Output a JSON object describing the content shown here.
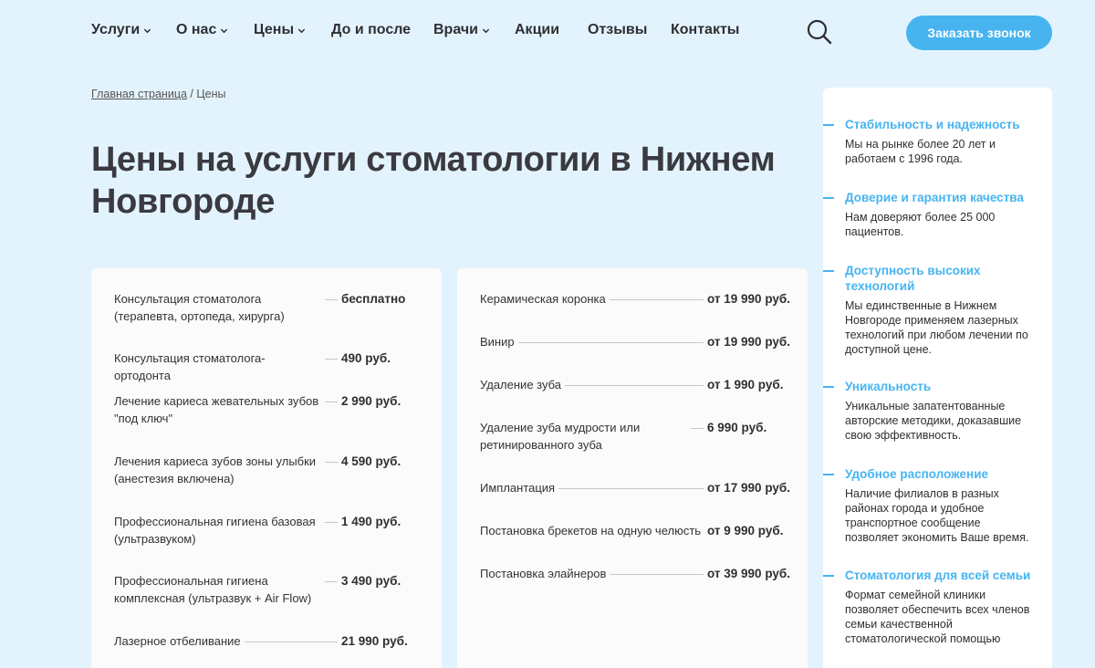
{
  "nav": {
    "items": [
      {
        "label": "Услуги",
        "dropdown": true
      },
      {
        "label": "О нас",
        "dropdown": true
      },
      {
        "label": "Цены",
        "dropdown": true
      },
      {
        "label": "До и после",
        "dropdown": false
      },
      {
        "label": "Врачи",
        "dropdown": true
      },
      {
        "label": "Акции",
        "dropdown": false
      },
      {
        "label": "Отзывы",
        "dropdown": false
      },
      {
        "label": "Контакты",
        "dropdown": false
      }
    ],
    "cta_label": "Заказать звонок",
    "search_icon": "search-icon"
  },
  "breadcrumb": {
    "home": "Главная страница",
    "separator": "/",
    "current": "Цены"
  },
  "page_title": "Цены на услуги стоматологии в Нижнем Новгороде",
  "prices_left": [
    {
      "name": "Консультация стоматолога (терапевта, ортопеда, хирурга)",
      "price": "бесплатно"
    },
    {
      "name": "Консультация стоматолога-ортодонта",
      "price": "490 руб."
    },
    {
      "name": "Лечение кариеса жевательных зубов \"под ключ\"",
      "price": "2 990 руб."
    },
    {
      "name": "Лечения кариеса зубов зоны улыбки (анестезия включена)",
      "price": "4 590 руб."
    },
    {
      "name": "Профессиональная гигиена базовая (ультразвуком)",
      "price": "1 490 руб."
    },
    {
      "name": "Профессиональная гигиена комплексная (ультразвук + Air Flow)",
      "price": "3 490 руб."
    },
    {
      "name": "Лазерное отбеливание",
      "price": "21 990 руб."
    }
  ],
  "prices_right": [
    {
      "name": "Керамическая коронка",
      "price": "от 19 990 руб."
    },
    {
      "name": "Винир",
      "price": "от 19 990 руб."
    },
    {
      "name": "Удаление зуба",
      "price": "от 1 990 руб."
    },
    {
      "name": "Удаление зуба мудрости или ретинированного зуба",
      "price": "6 990 руб."
    },
    {
      "name": "Имплантация",
      "price": "от 17 990 руб."
    },
    {
      "name": "Постановка брекетов на одную челюсть",
      "price": "от 9 990 руб."
    },
    {
      "name": "Постановка элайнеров",
      "price": "от 39 990 руб."
    }
  ],
  "features": [
    {
      "title": "Стабильность и надежность",
      "text": "Мы на рынке более 20 лет и работаем с 1996 года."
    },
    {
      "title": "Доверие и гарантия качества",
      "text": "Нам доверяют более 25 000 пациентов."
    },
    {
      "title": "Доступность высоких технологий",
      "text": "Мы единственные в Нижнем Новгороде применяем лазерных технологий при любом лечении по доступной цене."
    },
    {
      "title": "Уникальность",
      "text": "Уникальные запатентованные авторские методики, доказавшие свою эффективность."
    },
    {
      "title": "Удобное расположение",
      "text": "Наличие филиалов в разных районах города и удобное транспортное сообщение позволяет экономить Ваше время."
    },
    {
      "title": "Стоматология для всей семьи",
      "text": "Формат семейной клиники позволяет обеспечить всех членов семьи качественной стоматологической помощью"
    }
  ],
  "colors": {
    "background": "#e3f3fd",
    "accent": "#47b4f0",
    "card": "#fbfbfb",
    "text": "#2f2f33"
  }
}
